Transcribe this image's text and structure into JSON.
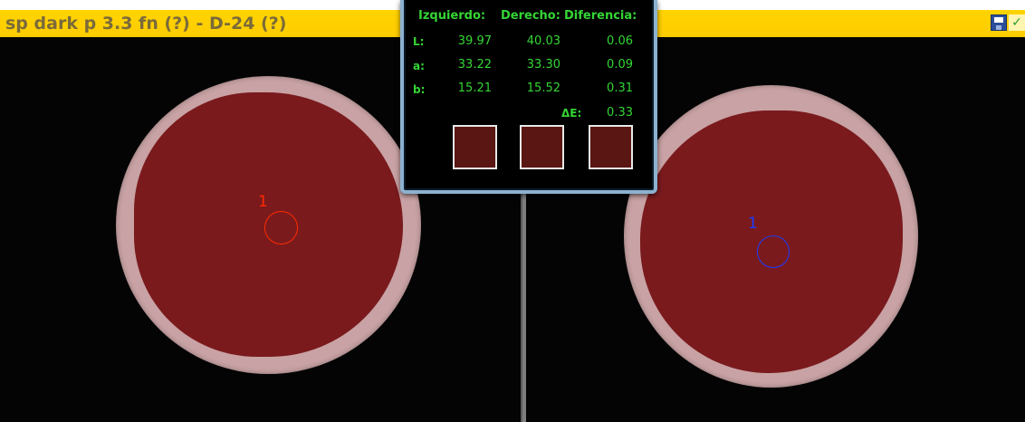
{
  "window": {
    "title": "sp dark p 3.3 fn (?) - D-24 (?)",
    "toolbar_icons": [
      "save-icon",
      "accept-check-icon"
    ]
  },
  "comparison": {
    "headers": {
      "left": "Izquierdo:",
      "right": "Derecho:",
      "difference": "Diferencia:"
    },
    "rows": [
      {
        "label": "L:",
        "left": "39.97",
        "right": "40.03",
        "diff": "0.06"
      },
      {
        "label": "a:",
        "left": "33.22",
        "right": "33.30",
        "diff": "0.09"
      },
      {
        "label": "b:",
        "left": "15.21",
        "right": "15.52",
        "diff": "0.31"
      }
    ],
    "delta_e": {
      "label": "ΔE:",
      "value": "0.33"
    },
    "swatch_colors": [
      "#5a1612",
      "#5a1612",
      "#5a1612"
    ]
  },
  "markers": {
    "left": {
      "number": "1",
      "color": "#ff2a00"
    },
    "right": {
      "number": "1",
      "color": "#1a3dff"
    }
  }
}
